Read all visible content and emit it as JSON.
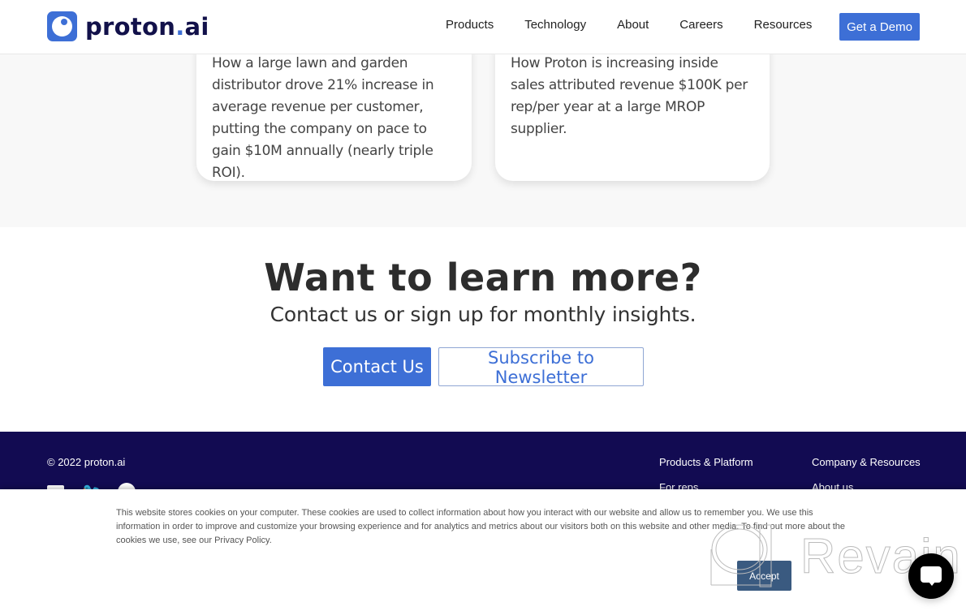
{
  "header": {
    "logo": {
      "name": "proton",
      "suffix_dot": ".",
      "suffix": "ai"
    },
    "nav": [
      "Products",
      "Technology",
      "About",
      "Careers",
      "Resources"
    ],
    "cta_label": "Get a Demo"
  },
  "cards": [
    {
      "text": "How a large lawn and garden distributor drove 21% increase in average revenue per customer, putting the company on pace to gain $10M annually (nearly triple ROI)."
    },
    {
      "text": "How Proton is increasing inside sales attributed revenue $100K per rep/per year at a large MROP supplier."
    }
  ],
  "cta": {
    "title": "Want to learn more?",
    "subtitle": "Contact us or sign up for monthly insights.",
    "contact_label": "Contact Us",
    "subscribe_label": "Subscribe to Newsletter"
  },
  "footer": {
    "copyright": "© 2022 proton.ai",
    "social": [
      "linkedin-icon",
      "twitter-icon",
      "github-icon"
    ],
    "columns": [
      {
        "heading": "Products & Platform",
        "links": [
          "For reps"
        ]
      },
      {
        "heading": "Company & Resources",
        "links": [
          "About us"
        ]
      }
    ]
  },
  "cookie_banner": {
    "text": "This website stores cookies on your computer. These cookies are used to collect information about how you interact with our website and allow us to remember you. We use this information in order to improve and customize your browsing experience and for analytics and metrics about our visitors both on this website and other media. To find out more about the cookies we use, see our Privacy Policy.",
    "accept_label": "Accept"
  },
  "watermark": {
    "text": "Revain"
  },
  "colors": {
    "brand_blue": "#3d6fd6",
    "navy": "#120b52",
    "accept": "#3a5a80"
  }
}
